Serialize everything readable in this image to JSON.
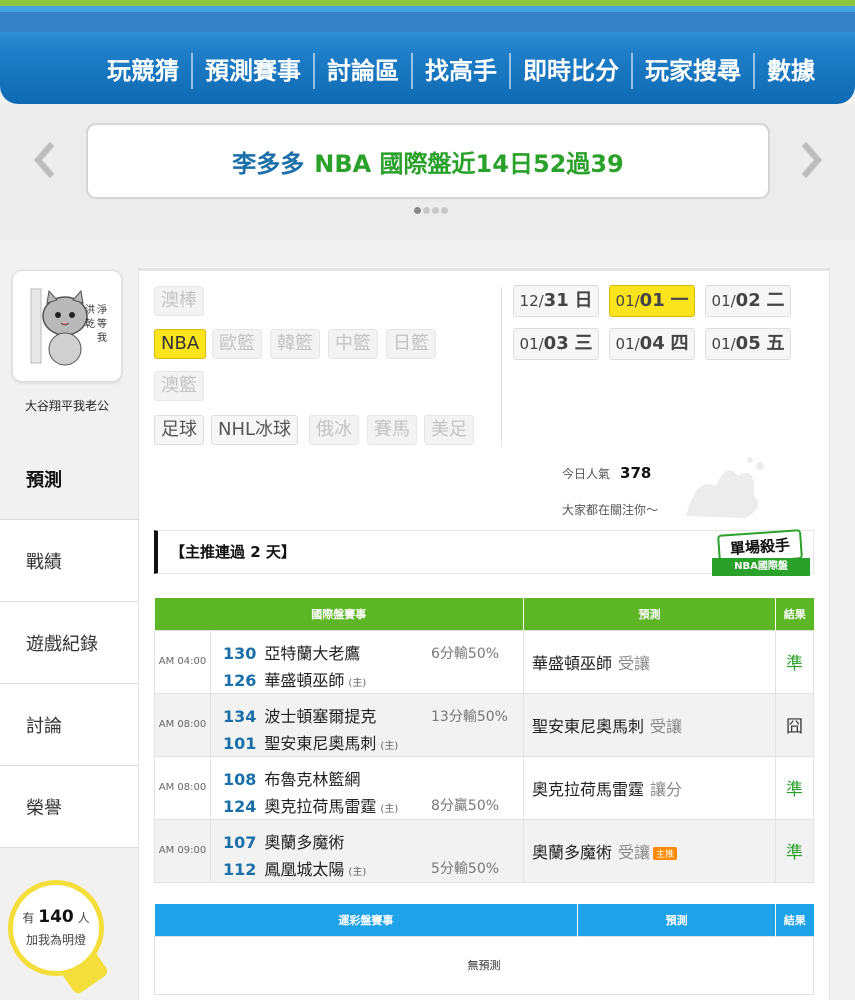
{
  "nav": {
    "items": [
      "玩競猜",
      "預測賽事",
      "討論區",
      "找高手",
      "即時比分",
      "玩家搜尋",
      "數據"
    ]
  },
  "banner": {
    "name": "李多多",
    "text": "NBA 國際盤近14日52過39",
    "prev_icon": "chevron-left-icon",
    "next_icon": "chevron-right-icon"
  },
  "profile": {
    "username": "大谷翔平我老公"
  },
  "sidebar": {
    "items": [
      {
        "label": "預測",
        "active": true
      },
      {
        "label": "戰績"
      },
      {
        "label": "遊戲紀錄"
      },
      {
        "label": "討論"
      },
      {
        "label": "榮譽"
      }
    ],
    "lamp": {
      "prefix": "有",
      "count": "140",
      "suffix": "人",
      "caption": "加我為明燈"
    }
  },
  "sports": {
    "row1": [
      "澳棒"
    ],
    "row2": [
      "NBA",
      "歐籃",
      "韓籃",
      "中籃",
      "日籃"
    ],
    "row3": [
      "澳籃"
    ],
    "row4": [
      "足球",
      "NHL冰球",
      "俄冰",
      "賽馬",
      "美足"
    ]
  },
  "dates": [
    {
      "md": "12/",
      "d": "31",
      "w": "日"
    },
    {
      "md": "01/",
      "d": "01",
      "w": "一"
    },
    {
      "md": "01/",
      "d": "02",
      "w": "二"
    },
    {
      "md": "01/",
      "d": "03",
      "w": "三"
    },
    {
      "md": "01/",
      "d": "04",
      "w": "四"
    },
    {
      "md": "01/",
      "d": "05",
      "w": "五"
    }
  ],
  "popularity": {
    "label": "今日人氣",
    "value": "378",
    "subtitle": "大家都在關注你〜"
  },
  "streak": {
    "text": "【主推連過 2 天】",
    "badge_title": "單場殺手",
    "badge_sub": "NBA國際盤"
  },
  "table1": {
    "headers": [
      "國際盤賽事",
      "預測",
      "結果"
    ],
    "rows": [
      {
        "time": "AM 04:00",
        "t1no": "130",
        "t1": "亞特蘭大老鷹",
        "t2no": "126",
        "t2": "華盛頓巫師",
        "home": "(主)",
        "hcap": "6分輸50%",
        "hcap_row": 1,
        "pred": "華盛頓巫師",
        "tag": "受讓",
        "main": "",
        "result": "準"
      },
      {
        "time": "AM 08:00",
        "t1no": "134",
        "t1": "波士頓塞爾提克",
        "t2no": "101",
        "t2": "聖安東尼奧馬刺",
        "home": "(主)",
        "hcap": "13分輸50%",
        "hcap_row": 1,
        "pred": "聖安東尼奧馬刺",
        "tag": "受讓",
        "main": "",
        "result": "囧"
      },
      {
        "time": "AM 08:00",
        "t1no": "108",
        "t1": "布魯克林籃網",
        "t2no": "124",
        "t2": "奧克拉荷馬雷霆",
        "home": "(主)",
        "hcap": "8分贏50%",
        "hcap_row": 2,
        "pred": "奧克拉荷馬雷霆",
        "tag": "讓分",
        "main": "",
        "result": "準"
      },
      {
        "time": "AM 09:00",
        "t1no": "107",
        "t1": "奧蘭多魔術",
        "t2no": "112",
        "t2": "鳳凰城太陽",
        "home": "(主)",
        "hcap": "5分輸50%",
        "hcap_row": 2,
        "pred": "奧蘭多魔術",
        "tag": "受讓",
        "main": "主推",
        "result": "準"
      }
    ]
  },
  "table2": {
    "headers": [
      "運彩盤賽事",
      "預測",
      "結果"
    ],
    "empty": "無預測"
  },
  "colors": {
    "accent_green": "#5cb626",
    "accent_blue": "#1fa3e8",
    "highlight": "#fbe41e",
    "nav_blue": "#1f7fc8"
  }
}
